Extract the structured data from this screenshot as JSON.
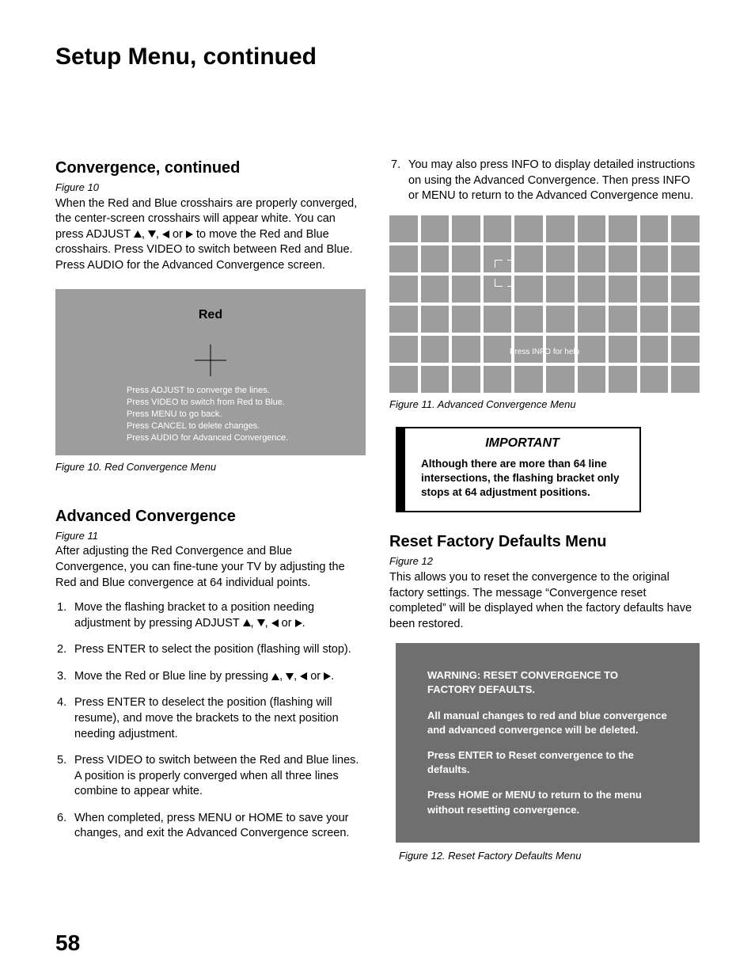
{
  "page": {
    "title": "Setup Menu, continued",
    "number": "58"
  },
  "left": {
    "convergence": {
      "heading": "Convergence, continued",
      "figref": "Figure 10",
      "body_pre": "When the Red and Blue crosshairs are properly converged, the center-screen crosshairs will appear white.  You can press ADJUST ",
      "body_post": " to move the Red and Blue crosshairs.  Press VIDEO to switch between Red and Blue.  Press AUDIO for the Advanced Convergence screen."
    },
    "fig10": {
      "label": "Red",
      "lines": [
        "Press ADJUST to converge the lines.",
        "Press VIDEO to switch from Red to Blue.",
        "Press MENU to go back.",
        "Press CANCEL to delete changes.",
        "Press AUDIO for Advanced Convergence."
      ],
      "caption": "Figure 10. Red Convergence Menu"
    },
    "advanced": {
      "heading": "Advanced Convergence",
      "figref": "Figure 11",
      "intro": "After adjusting the Red Convergence and Blue Convergence, you can fine-tune your TV by adjusting the Red and Blue convergence at 64 individual points.",
      "steps": {
        "s1_pre": "Move the flashing bracket to a position needing adjustment by pressing ADJUST ",
        "s1_post": ".",
        "s2": "Press ENTER to select the position (flashing will stop).",
        "s3_pre": "Move the Red or Blue line by pressing ",
        "s3_post": ".",
        "s4": "Press ENTER to deselect the position (flashing will resume), and move the brackets to the next position needing adjustment.",
        "s5": "Press VIDEO to switch between the Red and Blue lines.  A position is properly converged when all three lines combine to appear white.",
        "s6": "When completed, press MENU or HOME to save your changes, and exit the Advanced Convergence screen."
      }
    }
  },
  "right": {
    "step7": "You may also press INFO to display detailed instructions on using the Advanced Convergence.  Then press INFO or MENU to return to the Advanced Convergence menu.",
    "fig11": {
      "info_text": "Press INFO for help",
      "caption": "Figure 11.  Advanced Convergence Menu"
    },
    "important": {
      "hdr": "IMPORTANT",
      "body": "Although there are more than 64 line intersections, the flashing bracket only stops at 64 adjustment positions."
    },
    "reset": {
      "heading": "Reset Factory Defaults Menu",
      "figref": "Figure 12",
      "body": "This allows you to reset the convergence to the original factory settings.  The message “Convergence reset completed” will be displayed when the factory defaults have been restored."
    },
    "fig12": {
      "p1": "WARNING:  RESET CONVERGENCE TO FACTORY DEFAULTS.",
      "p2": "All manual changes to red and blue convergence and advanced convergence will be deleted.",
      "p3": "Press ENTER to Reset convergence to the defaults.",
      "p4": "Press HOME or MENU to return to the menu without resetting convergence.",
      "caption": "Figure 12. Reset Factory Defaults Menu"
    }
  }
}
